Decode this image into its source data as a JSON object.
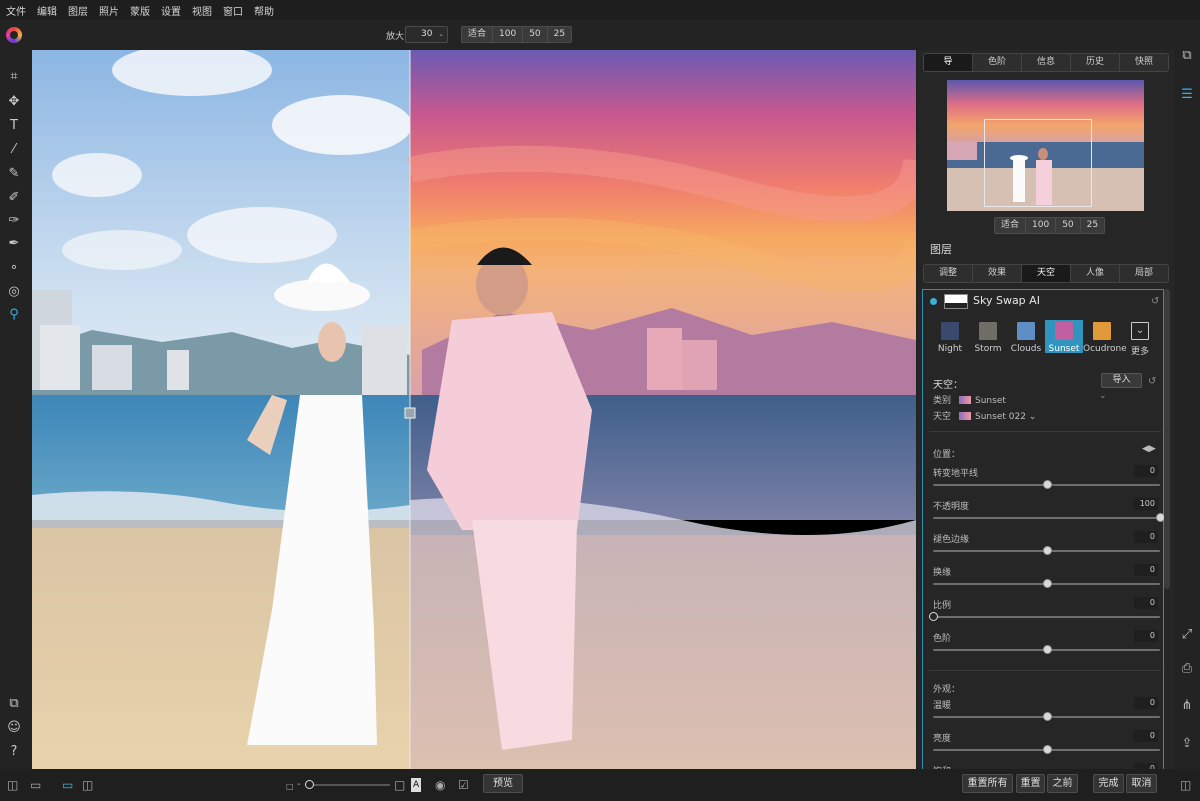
{
  "menu": [
    "文件",
    "编辑",
    "图层",
    "照片",
    "蒙版",
    "设置",
    "视图",
    "窗口",
    "帮助"
  ],
  "toolbar": {
    "zoom_label": "放大",
    "zoom_value": "30",
    "zoom_buttons": [
      "适合",
      "100",
      "50",
      "25"
    ]
  },
  "right_panel": {
    "top_tabs": [
      "导",
      "色阶",
      "信息",
      "历史",
      "快照"
    ],
    "active_top_tab": 0,
    "nav_zoom_buttons": [
      "适合",
      "100",
      "50",
      "25"
    ],
    "layers_title": "图层",
    "layer_tabs": [
      "调整",
      "效果",
      "天空",
      "人像",
      "局部"
    ],
    "active_layer_tab": 2,
    "layer_name": "Sky Swap AI",
    "presets": [
      {
        "label": "Night",
        "color": "#3a4a6e"
      },
      {
        "label": "Storm",
        "color": "#6e6e66"
      },
      {
        "label": "Clouds",
        "color": "#5e8fc4"
      },
      {
        "label": "Sunset",
        "color": "#c25fa0"
      },
      {
        "label": "Ocudrone",
        "color": "#e09a3a"
      },
      {
        "label": "更多",
        "color": "#262626"
      }
    ],
    "active_preset": 3,
    "sky_section_label": "天空：",
    "import_label": "导入",
    "category_label": "类别",
    "category_value": "Sunset",
    "sky_label": "天空",
    "sky_value": "Sunset 022",
    "position_label": "位置：",
    "sliders": [
      {
        "label": "转变地平线",
        "value": "0",
        "level": 0.5
      },
      {
        "label": "不透明度",
        "value": "100",
        "level": 1.0
      },
      {
        "label": "褪色边缘",
        "value": "0",
        "level": 0.5
      },
      {
        "label": "换缘",
        "value": "0",
        "level": 0.5
      },
      {
        "label": "比例",
        "value": "0",
        "level": 0.0
      },
      {
        "label": "色阶",
        "value": "0",
        "level": 0.5
      }
    ],
    "appearance_label": "外观：",
    "appearance_sliders": [
      {
        "label": "温暖",
        "value": "0",
        "level": 0.5
      },
      {
        "label": "亮度",
        "value": "0",
        "level": 0.5
      },
      {
        "label": "饱和",
        "value": "0",
        "level": 0.5
      }
    ]
  },
  "bottombar": {
    "preview_label": "预览",
    "reset_all_label": "重置所有",
    "reset_label": "重置",
    "before_label": "之前",
    "done_label": "完成",
    "cancel_label": "取消"
  },
  "colors": {
    "accent": "#2f95bf",
    "active_tool": "#36b3e6"
  }
}
